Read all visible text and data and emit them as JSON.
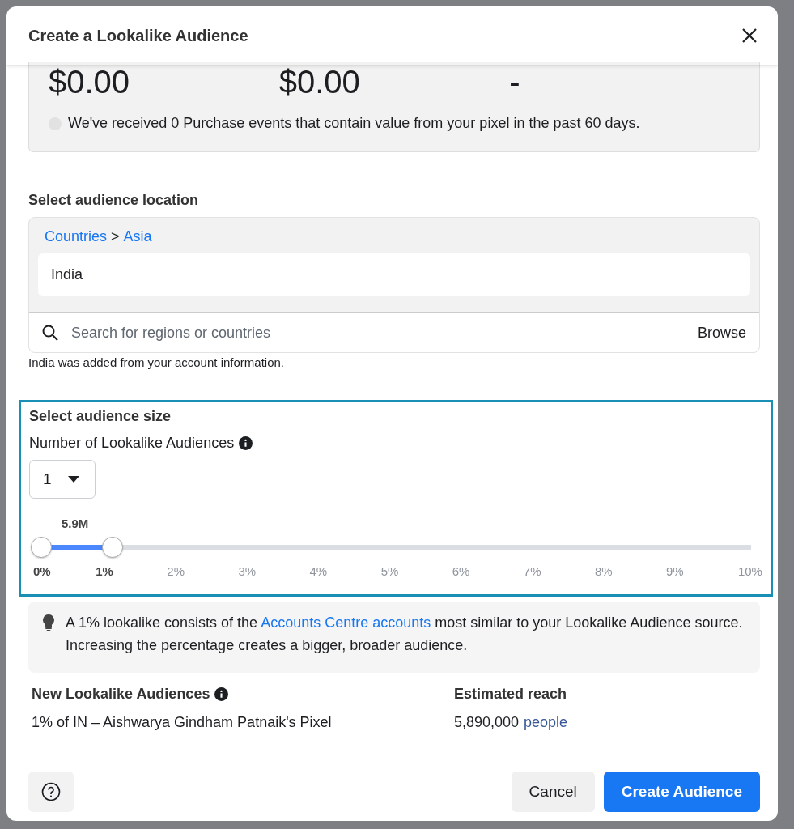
{
  "dialog": {
    "title": "Create a Lookalike Audience"
  },
  "stats": {
    "values": [
      "$0.00",
      "$0.00",
      "-"
    ],
    "note": "We've received 0 Purchase events that contain value from your pixel in the past 60 days."
  },
  "location": {
    "heading": "Select audience location",
    "breadcrumb": [
      "Countries",
      "Asia"
    ],
    "separator": ">",
    "selected": "India",
    "search_placeholder": "Search for regions or countries",
    "browse": "Browse",
    "note": "India was added from your account information."
  },
  "size": {
    "heading": "Select audience size",
    "count_label": "Number of Lookalike Audiences",
    "count_value": "1",
    "slider_reading": "5.9M",
    "level": 0.1,
    "ticks": [
      {
        "label": "0%",
        "selected": true
      },
      {
        "label": "1%",
        "selected": true
      },
      {
        "label": "2%",
        "selected": false
      },
      {
        "label": "3%",
        "selected": false
      },
      {
        "label": "4%",
        "selected": false
      },
      {
        "label": "5%",
        "selected": false
      },
      {
        "label": "6%",
        "selected": false
      },
      {
        "label": "7%",
        "selected": false
      },
      {
        "label": "8%",
        "selected": false
      },
      {
        "label": "9%",
        "selected": false
      },
      {
        "label": "10%",
        "selected": false
      }
    ]
  },
  "tip": {
    "before": "A 1% lookalike consists of the ",
    "link": "Accounts Centre accounts",
    "after": " most similar to your Lookalike Audience source. Increasing the percentage creates a bigger, broader audience."
  },
  "summary": {
    "audiences_label": "New Lookalike Audiences",
    "audience_name": "1% of IN – Aishwarya Gindham Patnaik's Pixel",
    "reach_label": "Estimated reach",
    "reach_value": "5,890,000",
    "reach_link": "people"
  },
  "buttons": [
    {
      "label": "Cancel",
      "kind": "secondary"
    },
    {
      "label": "Create Audience",
      "kind": "primary"
    }
  ]
}
